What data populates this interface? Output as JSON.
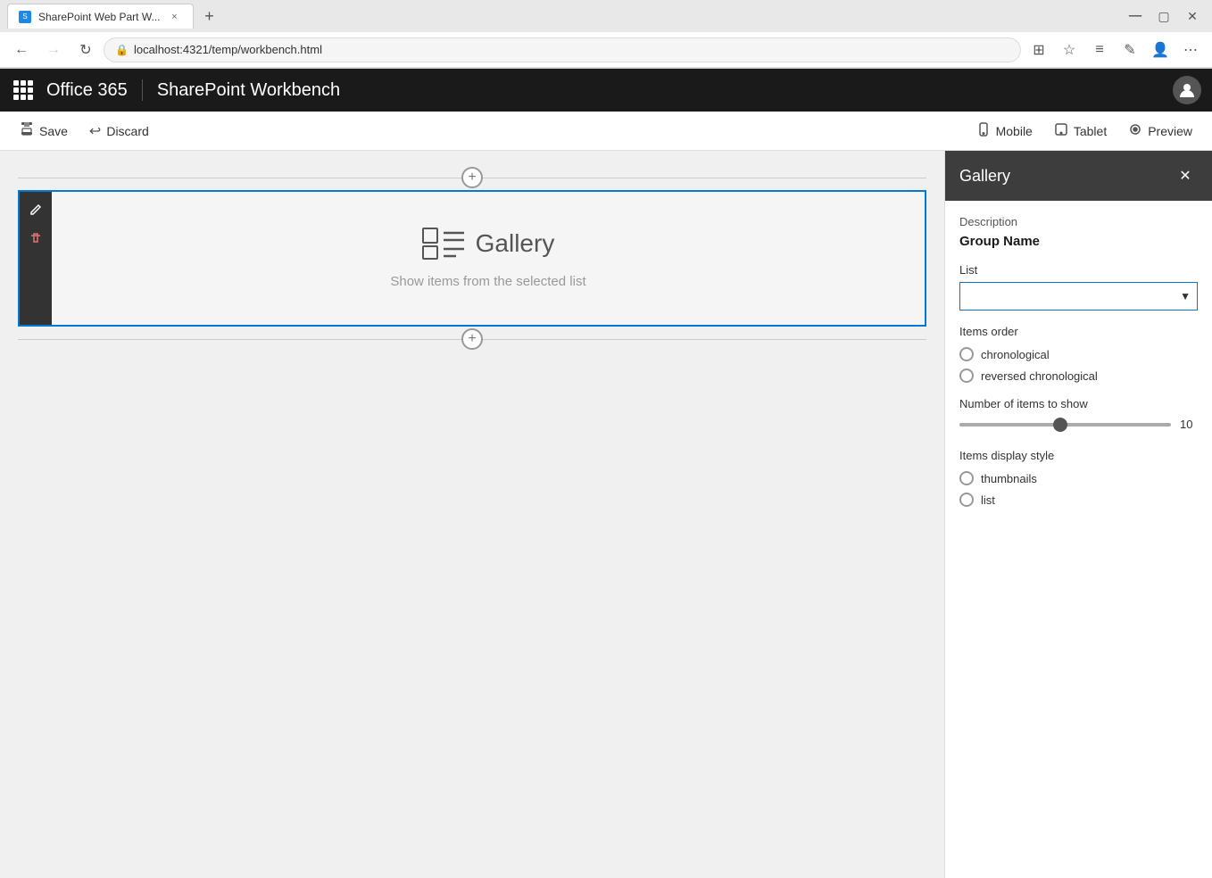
{
  "browser": {
    "tab_title": "SharePoint Web Part W...",
    "url": "localhost:4321/temp/workbench.html",
    "new_tab_icon": "+",
    "back_disabled": false,
    "forward_disabled": true
  },
  "app_header": {
    "brand": "Office 365",
    "divider": "|",
    "title": "SharePoint Workbench"
  },
  "toolbar": {
    "save_label": "Save",
    "discard_label": "Discard",
    "mobile_label": "Mobile",
    "tablet_label": "Tablet",
    "preview_label": "Preview"
  },
  "webpart": {
    "title": "Gallery",
    "subtitle": "Show items from the selected list"
  },
  "panel": {
    "title": "Gallery",
    "close_icon": "×",
    "description_label": "Description",
    "group_name_label": "Group Name",
    "list_label": "List",
    "items_order_label": "Items order",
    "order_options": [
      {
        "label": "chronological",
        "value": "chronological"
      },
      {
        "label": "reversed chronological",
        "value": "reversed_chronological"
      }
    ],
    "num_items_label": "Number of items to show",
    "num_items_value": "10",
    "display_style_label": "Items display style",
    "display_options": [
      {
        "label": "thumbnails"
      },
      {
        "label": "list"
      }
    ]
  }
}
